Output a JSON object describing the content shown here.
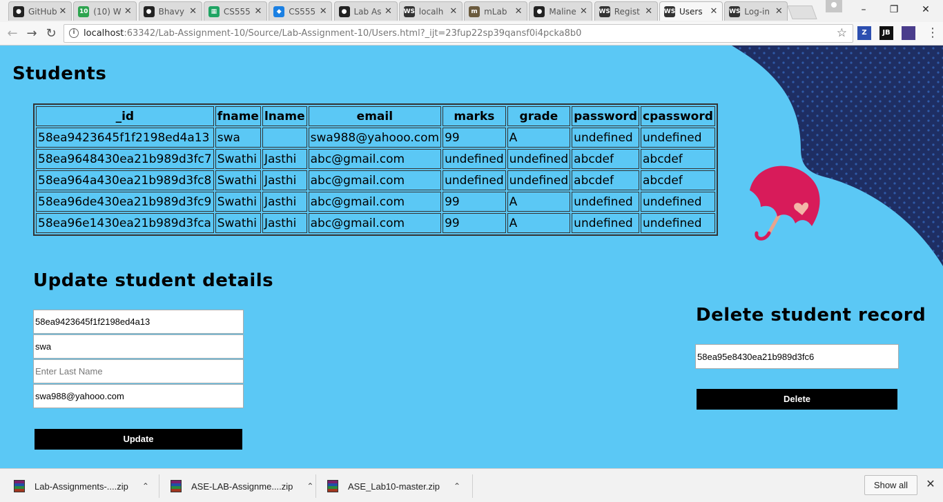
{
  "browser": {
    "tabs": [
      {
        "label": "GitHub",
        "icon": "github-icon"
      },
      {
        "label": "(10) W",
        "icon": "notification-count-icon"
      },
      {
        "label": "Bhavy",
        "icon": "github-icon"
      },
      {
        "label": "CS555",
        "icon": "sheets-icon"
      },
      {
        "label": "CS555",
        "icon": "dropbox-icon"
      },
      {
        "label": "Lab As",
        "icon": "github-icon"
      },
      {
        "label": "localh",
        "icon": "webstorm-icon"
      },
      {
        "label": "mLab",
        "icon": "mlab-icon"
      },
      {
        "label": "Maline",
        "icon": "github-icon"
      },
      {
        "label": "Regist",
        "icon": "webstorm-icon"
      },
      {
        "label": "Users",
        "icon": "webstorm-icon"
      },
      {
        "label": "Log-in",
        "icon": "webstorm-icon"
      }
    ],
    "active_tab_index": 10,
    "url_host": "localhost",
    "url_rest": ":63342/Lab-Assignment-10/Source/Lab-Assignment-10/Users.html?_ijt=23fup22sp39qansf0i4pcka8b0",
    "extensions": [
      {
        "label": "Z",
        "color": "#2d4fb0"
      },
      {
        "label": "JB",
        "color": "#111111"
      },
      {
        "label": "",
        "color": "#4a3d8c"
      }
    ]
  },
  "page": {
    "background_color": "#5bc8f5",
    "students_title": "Students",
    "table": {
      "headers": [
        "_id",
        "fname",
        "lname",
        "email",
        "marks",
        "grade",
        "password",
        "cpassword"
      ],
      "rows": [
        [
          "58ea9423645f1f2198ed4a13",
          "swa",
          "",
          "swa988@yahooo.com",
          "99",
          "A",
          "undefined",
          "undefined"
        ],
        [
          "58ea9648430ea21b989d3fc7",
          "Swathi",
          "Jasthi",
          "abc@gmail.com",
          "undefined",
          "undefined",
          "abcdef",
          "abcdef"
        ],
        [
          "58ea964a430ea21b989d3fc8",
          "Swathi",
          "Jasthi",
          "abc@gmail.com",
          "undefined",
          "undefined",
          "abcdef",
          "abcdef"
        ],
        [
          "58ea96de430ea21b989d3fc9",
          "Swathi",
          "Jasthi",
          "abc@gmail.com",
          "99",
          "A",
          "undefined",
          "undefined"
        ],
        [
          "58ea96e1430ea21b989d3fca",
          "Swathi",
          "Jasthi",
          "abc@gmail.com",
          "99",
          "A",
          "undefined",
          "undefined"
        ]
      ]
    },
    "update": {
      "title": "Update student details",
      "id_value": "58ea9423645f1f2198ed4a13",
      "first_name_value": "swa",
      "last_name_placeholder": "Enter Last Name",
      "email_value": "swa988@yahooo.com",
      "button_label": "Update"
    },
    "delete": {
      "title": "Delete student record",
      "id_value": "58ea95e8430ea21b989d3fc6",
      "button_label": "Delete"
    }
  },
  "downloads": {
    "items": [
      {
        "label": "Lab-Assignments-....zip"
      },
      {
        "label": "ASE-LAB-Assignme....zip"
      },
      {
        "label": "ASE_Lab10-master.zip"
      }
    ],
    "show_all_label": "Show all"
  }
}
